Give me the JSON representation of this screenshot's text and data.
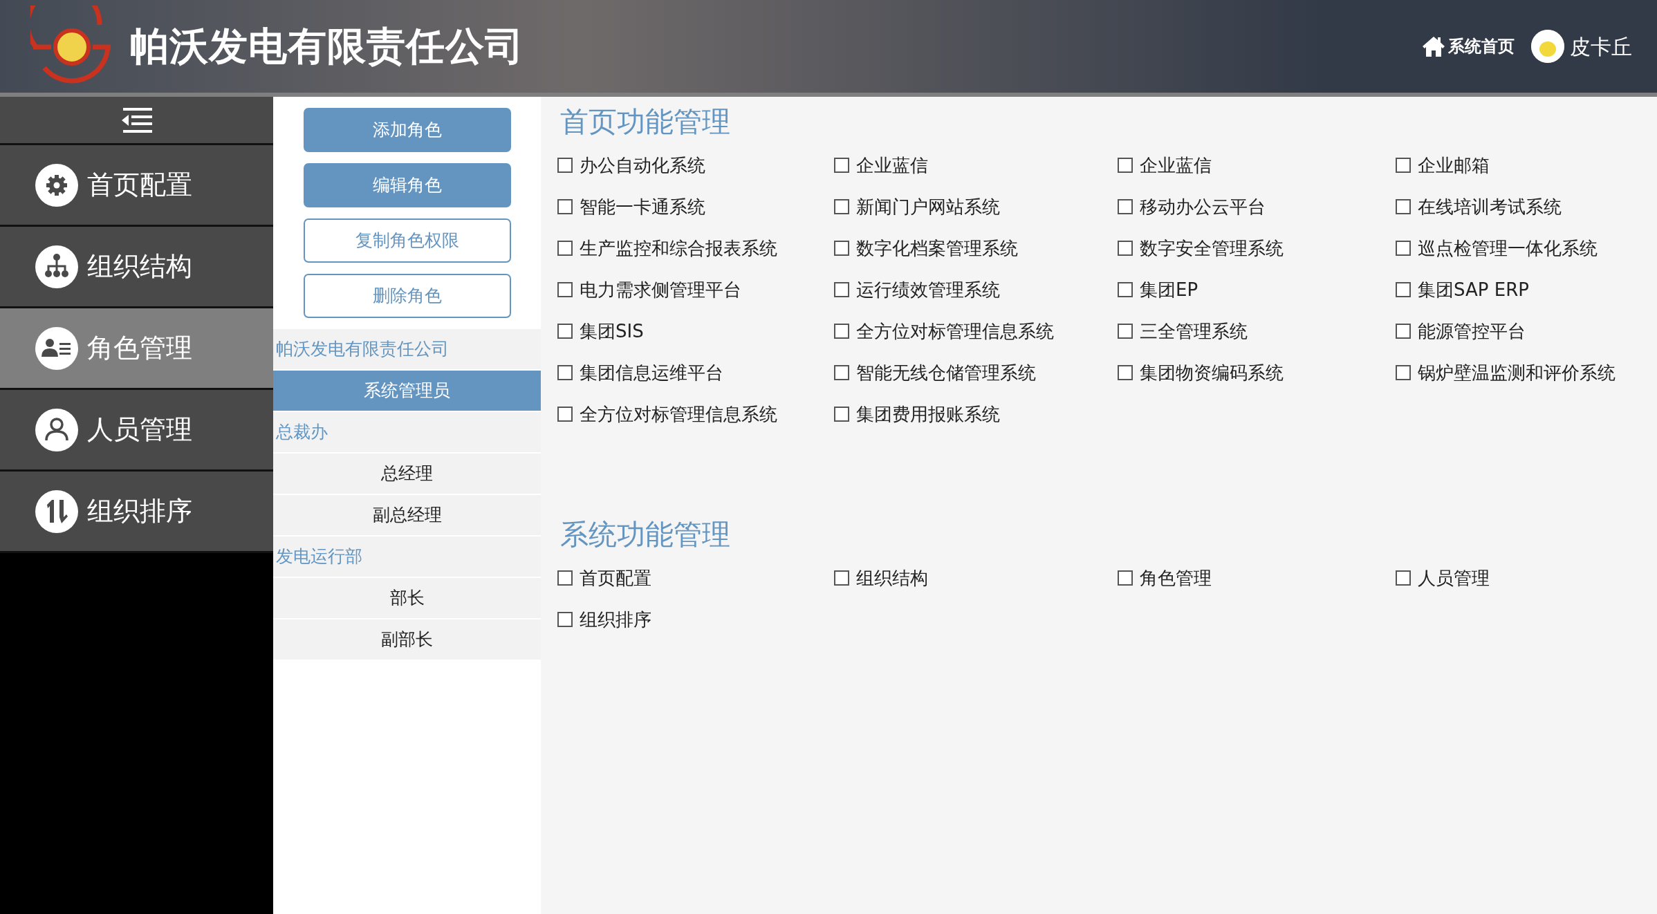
{
  "header": {
    "title": "帕沃发电有限责任公司",
    "home_link": "系统首页",
    "user_name": "皮卡丘"
  },
  "sidebar": {
    "items": [
      {
        "label": "首页配置",
        "selected": false
      },
      {
        "label": "组织结构",
        "selected": false
      },
      {
        "label": "角色管理",
        "selected": true
      },
      {
        "label": "人员管理",
        "selected": false
      },
      {
        "label": "组织排序",
        "selected": false
      }
    ]
  },
  "role_panel": {
    "buttons": [
      {
        "label": "添加角色",
        "kind": "primary"
      },
      {
        "label": "编辑角色",
        "kind": "primary"
      },
      {
        "label": "复制角色权限",
        "kind": "outline"
      },
      {
        "label": "删除角色",
        "kind": "outline"
      }
    ],
    "tree": [
      {
        "label": "帕沃发电有限责任公司",
        "children": [
          {
            "label": "系统管理员",
            "selected": true
          }
        ]
      },
      {
        "label": "总裁办",
        "children": [
          {
            "label": "总经理",
            "selected": false
          },
          {
            "label": "副总经理",
            "selected": false
          }
        ]
      },
      {
        "label": "发电运行部",
        "children": [
          {
            "label": "部长",
            "selected": false
          },
          {
            "label": "副部长",
            "selected": false
          }
        ]
      }
    ]
  },
  "sections": [
    {
      "title": "首页功能管理",
      "options": [
        {
          "label": "办公自动化系统",
          "checked": false
        },
        {
          "label": "企业蓝信",
          "checked": false
        },
        {
          "label": "企业蓝信",
          "checked": false
        },
        {
          "label": "企业邮箱",
          "checked": false
        },
        {
          "label": "智能一卡通系统",
          "checked": false
        },
        {
          "label": "新闻门户网站系统",
          "checked": false
        },
        {
          "label": "移动办公云平台",
          "checked": false
        },
        {
          "label": "在线培训考试系统",
          "checked": false
        },
        {
          "label": "生产监控和综合报表系统",
          "checked": false
        },
        {
          "label": "数字化档案管理系统",
          "checked": false
        },
        {
          "label": "数字安全管理系统",
          "checked": false
        },
        {
          "label": "巡点检管理一体化系统",
          "checked": false
        },
        {
          "label": "电力需求侧管理平台",
          "checked": false
        },
        {
          "label": "运行绩效管理系统",
          "checked": false
        },
        {
          "label": "集团EP",
          "checked": false
        },
        {
          "label": "集团SAP ERP",
          "checked": false
        },
        {
          "label": "集团SIS",
          "checked": false
        },
        {
          "label": "全方位对标管理信息系统",
          "checked": false
        },
        {
          "label": "三全管理系统",
          "checked": false
        },
        {
          "label": "能源管控平台",
          "checked": false
        },
        {
          "label": "集团信息运维平台",
          "checked": false
        },
        {
          "label": "智能无线仓储管理系统",
          "checked": false
        },
        {
          "label": "集团物资编码系统",
          "checked": false
        },
        {
          "label": "锅炉壁温监测和评价系统",
          "checked": false
        },
        {
          "label": "全方位对标管理信息系统",
          "checked": false
        },
        {
          "label": "集团费用报账系统",
          "checked": false
        }
      ]
    },
    {
      "title": "系统功能管理",
      "options": [
        {
          "label": "首页配置",
          "checked": false
        },
        {
          "label": "组织结构",
          "checked": false
        },
        {
          "label": "角色管理",
          "checked": false
        },
        {
          "label": "人员管理",
          "checked": false
        },
        {
          "label": "组织排序",
          "checked": false
        }
      ]
    }
  ]
}
